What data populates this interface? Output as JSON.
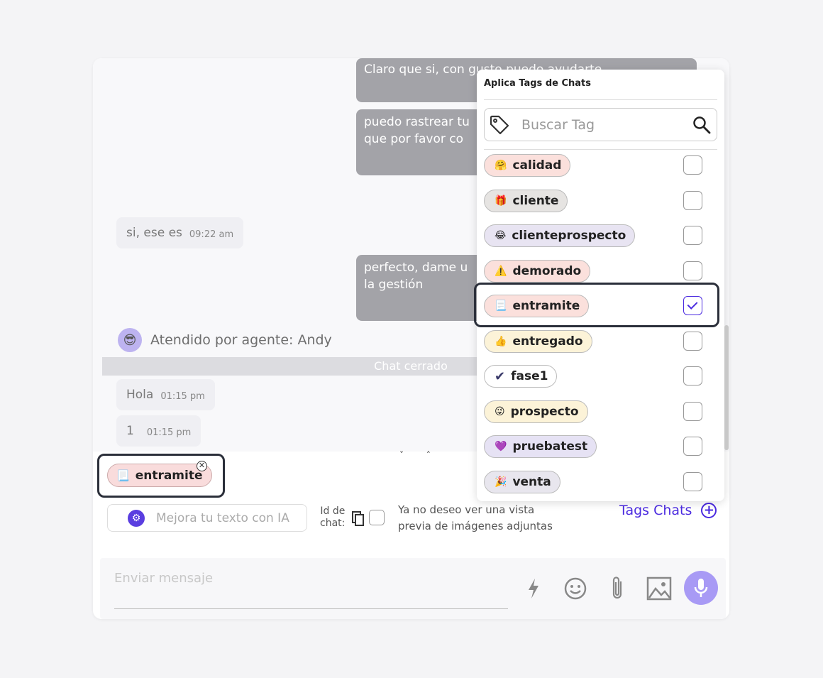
{
  "chat": {
    "messages_out": [
      "Claro que si, con gusto puedo ayudarte",
      "puedo rastrear tu\nque por favor co",
      "perfecto, dame u\nla gestión"
    ],
    "msg_in_1": {
      "text": "si, ese es",
      "time": "09:22 am"
    },
    "agent_label": "Atendido por agente: Andy",
    "closed_label": "Chat cerrado",
    "msg_in_2": {
      "text": "Hola",
      "time": "01:15 pm"
    },
    "msg_in_3": {
      "text": "1",
      "time": "01:15 pm"
    },
    "scroll_arrows": "˅ ˄"
  },
  "applied_tag": {
    "label": "entramite",
    "icon": "📃"
  },
  "toolbar": {
    "ia_placeholder": "Mejora tu texto con IA",
    "chat_id_label_1": "Id de",
    "chat_id_label_2": "chat:",
    "preview_text": "Ya no deseo ver una vista previa de imágenes adjuntas",
    "tags_chats": "Tags Chats"
  },
  "compose": {
    "placeholder": "Enviar mensaje"
  },
  "dropdown": {
    "title": "Aplica Tags de Chats",
    "search_placeholder": "Buscar Tag",
    "tags": [
      {
        "label": "calidad",
        "icon": "🤗",
        "bg": "#fbe0dc",
        "checked": false
      },
      {
        "label": "cliente",
        "icon": "🎁",
        "bg": "#e6e4e2",
        "checked": false
      },
      {
        "label": "clienteprospecto",
        "icon": "😂",
        "bg": "#e8e4f2",
        "checked": false
      },
      {
        "label": "demorado",
        "icon": "⚠️",
        "bg": "#fbe0dc",
        "checked": false
      },
      {
        "label": "entramite",
        "icon": "📃",
        "bg": "#fbe0dc",
        "checked": true
      },
      {
        "label": "entregado",
        "icon": "👍",
        "bg": "#fcf3d8",
        "checked": false
      },
      {
        "label": "fase1",
        "icon": "✔",
        "bg": "#ffffff",
        "checked": false
      },
      {
        "label": "prospecto",
        "icon": "😜",
        "bg": "#fcf3d8",
        "checked": false
      },
      {
        "label": "pruebatest",
        "icon": "💜",
        "bg": "#e6e2f4",
        "checked": false
      },
      {
        "label": "venta",
        "icon": "🎉",
        "bg": "#e8e6ee",
        "checked": false
      }
    ]
  }
}
